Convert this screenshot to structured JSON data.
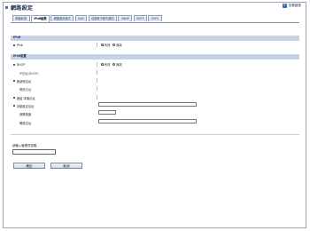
{
  "page": {
    "title": "網路設定",
    "help_label": "查看變更"
  },
  "tabs": [
    {
      "label": "網路狀態",
      "active": false
    },
    {
      "label": "IPv6組態",
      "active": true
    },
    {
      "label": "網路應用程式",
      "active": false
    },
    {
      "label": "DNS",
      "active": false
    },
    {
      "label": "自動電子郵件通知",
      "active": false
    },
    {
      "label": "SNMP",
      "active": false
    },
    {
      "label": "SMTP",
      "active": false
    },
    {
      "label": "POP3",
      "active": false
    }
  ],
  "sections": {
    "ipv6": "IPv6",
    "ipv6_settings": "IPv6設置"
  },
  "ipv6_row": {
    "label": "IPv6",
    "options": [
      {
        "label": "有效",
        "selected": true
      },
      {
        "label": "無效",
        "selected": false
      }
    ]
  },
  "settings_rows": {
    "dhcp": {
      "label": "DHCP",
      "options": [
        {
          "label": "有效",
          "selected": true
        },
        {
          "label": "無效",
          "selected": false
        }
      ]
    },
    "ip_dhcp": {
      "label": "IP位址(DHCP)",
      "value": ""
    },
    "stateless_address": {
      "label": "無狀態位址",
      "value": ""
    },
    "gateway_address": {
      "label": "閘道位址",
      "value": ""
    },
    "link_local_address": {
      "label": "連結-本端位址",
      "value": ""
    },
    "manual_address": {
      "label": "手動設定位址",
      "value": ""
    },
    "prefix_length": {
      "label": "首碼長度",
      "value": ""
    },
    "gateway": {
      "label": "閘道位址",
      "value": ""
    }
  },
  "password": {
    "label": "請輸入管理員密碼。",
    "value": ""
  },
  "buttons": {
    "ok": "確定",
    "cancel": "取消"
  }
}
